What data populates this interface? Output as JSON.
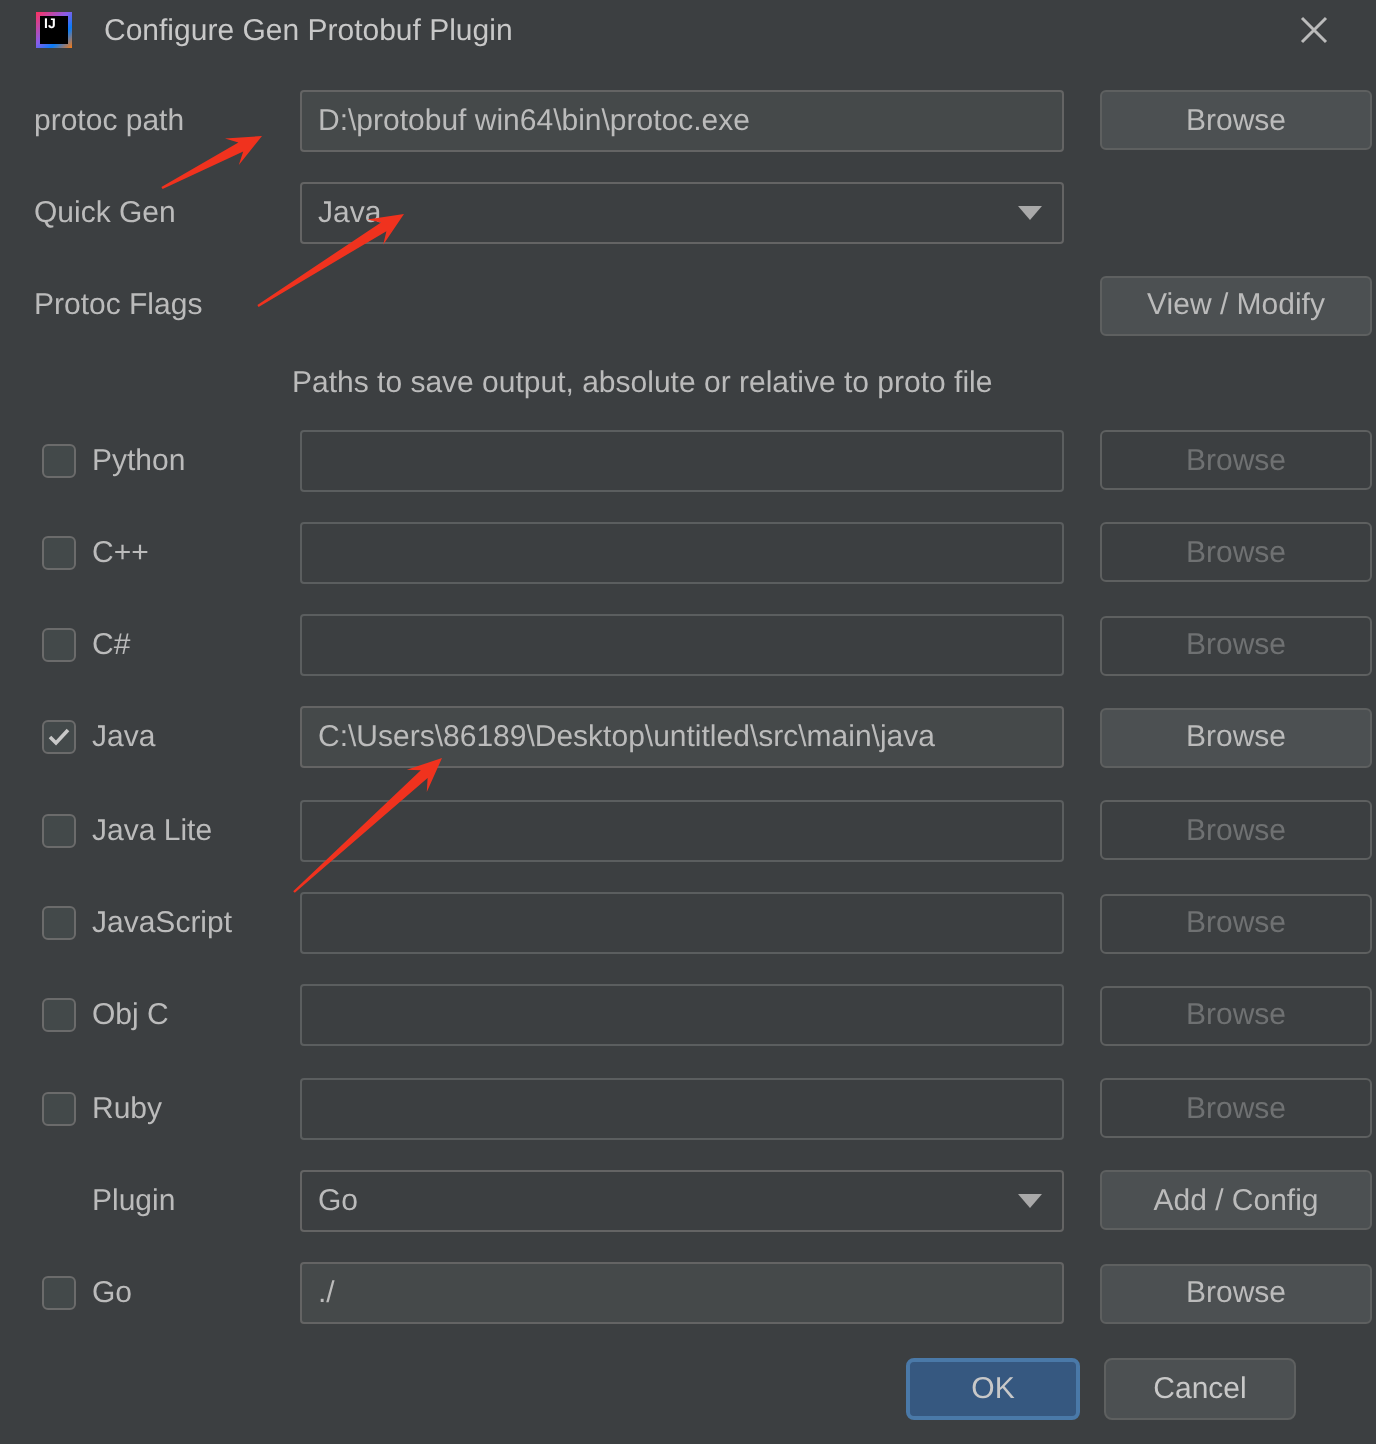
{
  "window": {
    "title": "Configure Gen Protobuf Plugin",
    "logo": "IJ"
  },
  "settings": [
    {
      "kind": "path",
      "label": "protoc path",
      "value": "D:\\protobuf win64\\bin\\protoc.exe",
      "button": {
        "label": "Browse",
        "disabled": false
      }
    },
    {
      "kind": "dropdown",
      "label": "Quick Gen",
      "value": "Java"
    },
    {
      "kind": "action",
      "label": "Protoc Flags",
      "button": {
        "label": "View / Modify",
        "disabled": false
      }
    }
  ],
  "output_hint": "Paths to save output, absolute or relative to proto file",
  "languages": [
    {
      "kind": "language",
      "label": "Python",
      "checked": false,
      "disabled": true,
      "button": "Browse"
    },
    {
      "kind": "language",
      "label": "C++",
      "checked": false,
      "disabled": true,
      "button": "Browse"
    },
    {
      "kind": "language",
      "label": "C#",
      "checked": false,
      "disabled": true,
      "button": "Browse"
    },
    {
      "kind": "language",
      "label": "Java",
      "checked": true,
      "disabled": false,
      "value": "C:\\Users\\86189\\Desktop\\untitled\\src\\main\\java",
      "button": "Browse"
    },
    {
      "kind": "language",
      "label": "Java Lite",
      "checked": false,
      "disabled": true,
      "button": "Browse"
    },
    {
      "kind": "language",
      "label": "JavaScript",
      "checked": false,
      "disabled": true,
      "button": "Browse"
    },
    {
      "kind": "language",
      "label": "Obj C",
      "checked": false,
      "disabled": true,
      "button": "Browse"
    },
    {
      "kind": "language",
      "label": "Ruby",
      "checked": false,
      "disabled": true,
      "button": "Browse"
    },
    {
      "kind": "plugin",
      "label": "Plugin",
      "value": "Go",
      "button": "Add / Config"
    },
    {
      "kind": "language",
      "label": "Go",
      "checked": false,
      "disabled": false,
      "value": "./",
      "button": "Browse"
    }
  ],
  "footer": {
    "buttons": [
      {
        "label": "OK",
        "default": true
      },
      {
        "label": "Cancel",
        "default": false
      }
    ]
  }
}
